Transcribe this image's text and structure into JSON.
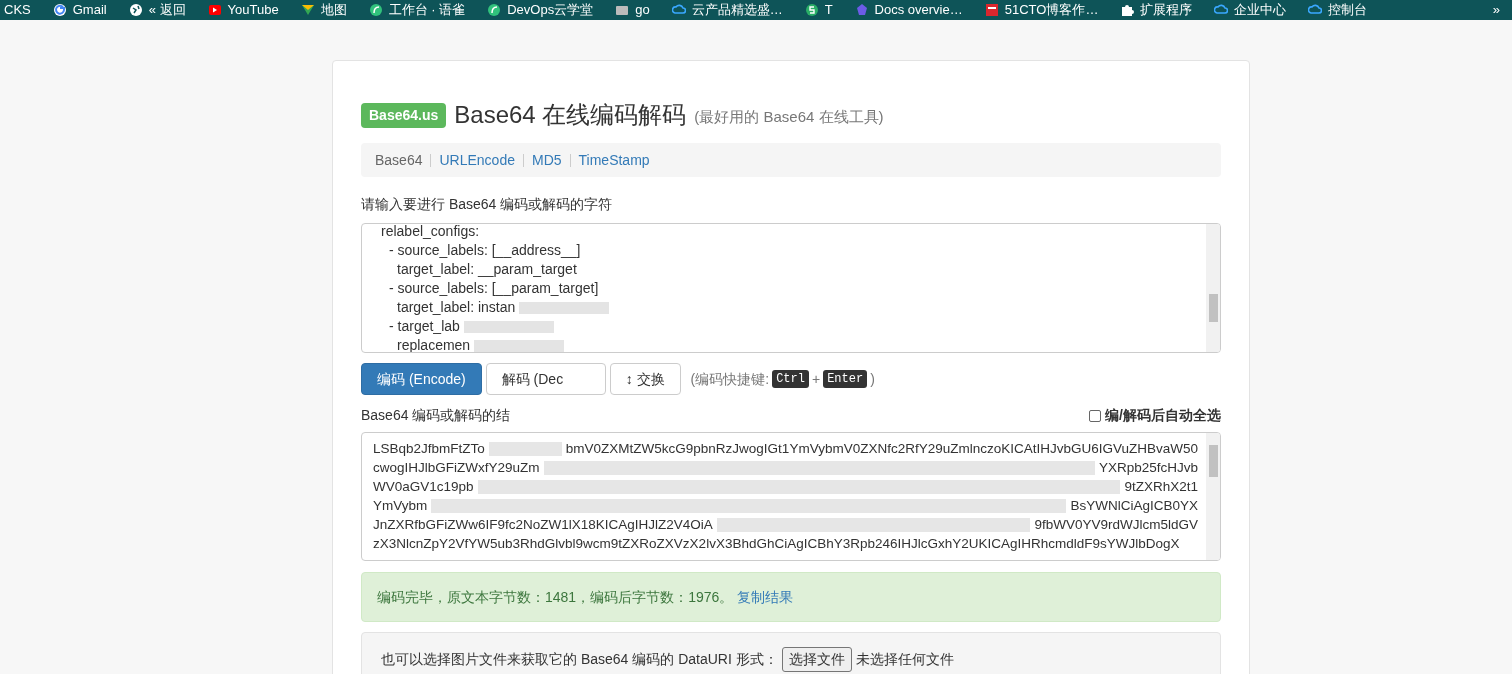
{
  "bookmarks": [
    "CKS",
    "Gmail",
    "« 返回",
    "YouTube",
    "地图",
    "工作台 · 语雀",
    "DevOps云学堂",
    "go",
    "云产品精选盛…",
    "T",
    "Docs overvie…",
    "51CTO博客作…",
    "扩展程序",
    "企业中心",
    "控制台"
  ],
  "bookmarks_more": "»",
  "header": {
    "badge": "Base64.us",
    "title": "Base64 在线编码解码",
    "subtitle": "(最好用的 Base64 在线工具)"
  },
  "nav": [
    {
      "label": "Base64",
      "selected": true
    },
    {
      "label": "URLEncode",
      "selected": false
    },
    {
      "label": "MD5",
      "selected": false
    },
    {
      "label": "TimeStamp",
      "selected": false
    }
  ],
  "input_label": "请输入要进行 Base64 编码或解码的字符",
  "input_lines": [
    {
      "text": "relabel_configs:",
      "redacted": false,
      "children": [
        {
          "text": "- source_labels: [__address__]",
          "redacted": false,
          "children": [
            {
              "text": "target_label: __param_target",
              "redacted": false
            }
          ]
        },
        {
          "text": "- source_labels: [__param_target]",
          "redacted": false,
          "children": [
            {
              "text": "target_label: instan",
              "redacted": true
            }
          ]
        },
        {
          "text": "- target_lab",
          "redacted": true,
          "children": [
            {
              "text": "replacemen",
              "redacted": true
            }
          ]
        }
      ]
    }
  ],
  "buttons": [
    {
      "label": "编码 (Encode)",
      "kind": "primary"
    },
    {
      "label": "解码 (Dec",
      "kind": "default"
    },
    {
      "label": "↕ 交换",
      "kind": "default"
    }
  ],
  "shortcut": {
    "prefix": "(编码快捷键:",
    "keys": [
      "Ctrl",
      "Enter"
    ],
    "plus": "+",
    "suffix": ")"
  },
  "output_label": "Base64 编码或解码的结",
  "auto_select": {
    "label": "编/解码后自动全选",
    "checked": false
  },
  "output_rows": [
    {
      "start": "LSBqb2JfbmFtZTo",
      "end": "bmV0ZXMtZW5kcG9pbnRzJwogIGt1YmVybmV0ZXNfc2RfY29uZmlnczoKICAtIHJvbGU6IGVuZHBvaW50"
    },
    {
      "start": "cwogIHJlbGFiZWxfY29uZm",
      "end": "YXRpb25fcHJvb"
    },
    {
      "start": "WV0aGV1c19pb",
      "end": "9tZXRhX2t1"
    },
    {
      "start": "YmVybm",
      "end": "BsYWNlCiAgICB0YX"
    },
    {
      "start": "JnZXRfbGFiZWw6IF9fc2NoZW1lX18KICAgIHJlZ2V4OiA",
      "end": "9fbWV0YV9rdWJlcm5ldGV"
    },
    {
      "start": "zX3NlcnZpY2VfYW5ub3RhdGlvbl9wcm9tZXRoZXVzX2lvX3BhdGhCiAgICBhY3Rpb246IHJlcGxhY2UKICAgIHRhcmdldF9sYWJlbDogX",
      "end": ""
    }
  ],
  "result": {
    "message": "编码完毕，原文本字节数：1481，编码后字节数：1976。",
    "link": "复制结果"
  },
  "file_pick": {
    "label": "也可以选择图片文件来获取它的 Base64 编码的 DataURI 形式：",
    "button": "选择文件",
    "status": "未选择任何文件"
  }
}
